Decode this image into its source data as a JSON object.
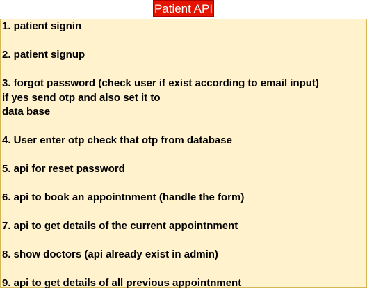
{
  "title": "Patient API",
  "colors": {
    "title_bg": "#e51400",
    "box_bg": "#fff2cc",
    "box_border": "#d6b656"
  },
  "lines": [
    "1. patient signin",
    "",
    "2. patient signup",
    "",
    "3. forgot password (check user if exist according to email input)",
    "if yes send otp and also set it to",
    "data base",
    "",
    "4. User enter otp check that otp from database",
    "",
    "5. api for reset password",
    "",
    "6. api to book an appointnment (handle the form)",
    "",
    "7. api to get details of the current appointnment",
    "",
    "8. show doctors (api already exist in admin)",
    "",
    "9. api to get details of all previous appointnment"
  ]
}
